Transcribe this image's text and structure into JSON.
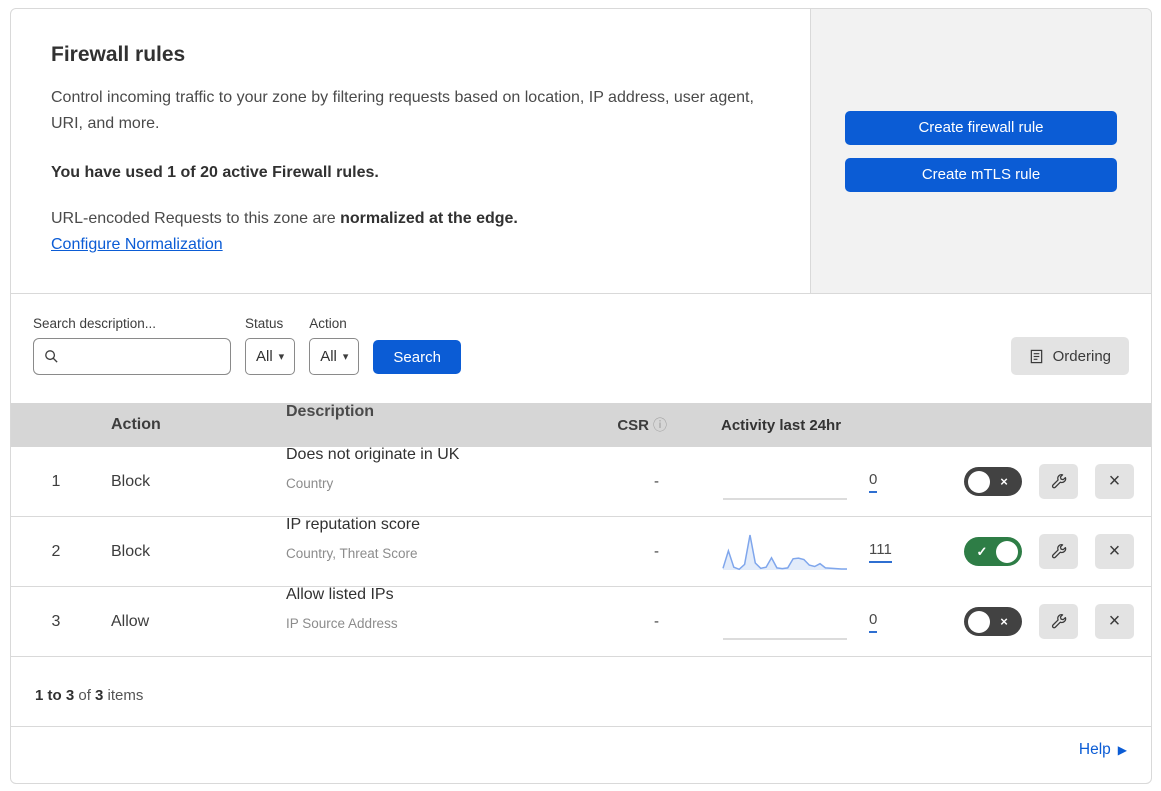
{
  "header": {
    "title": "Firewall rules",
    "description": "Control incoming traffic to your zone by filtering requests based on location, IP address, user agent, URI, and more.",
    "usage": "You have used 1 of 20 active Firewall rules.",
    "normalization_text": "URL-encoded Requests to this zone are ",
    "normalization_bold": "normalized at the edge.",
    "normalization_link": "Configure Normalization"
  },
  "actions_panel": {
    "create_firewall_rule": "Create firewall rule",
    "create_mtls_rule": "Create mTLS rule"
  },
  "filters": {
    "search_label": "Search description...",
    "search_value": "",
    "status_label": "Status",
    "status_value": "All",
    "action_label": "Action",
    "action_value": "All",
    "search_button": "Search",
    "ordering_button": "Ordering"
  },
  "table": {
    "columns": {
      "action": "Action",
      "description": "Description",
      "csr": "CSR",
      "activity": "Activity last 24hr"
    },
    "rows": [
      {
        "index": "1",
        "action": "Block",
        "title": "Does not originate in UK",
        "subtitle": "Country",
        "csr": "-",
        "count": "0",
        "enabled": false,
        "sparkline": null
      },
      {
        "index": "2",
        "action": "Block",
        "title": "IP reputation score",
        "subtitle": "Country, Threat Score",
        "csr": "-",
        "count": "111",
        "enabled": true,
        "sparkline": [
          5,
          55,
          8,
          2,
          16,
          100,
          20,
          5,
          8,
          35,
          6,
          4,
          6,
          32,
          34,
          30,
          14,
          10,
          18,
          6,
          5,
          4,
          3,
          3
        ]
      },
      {
        "index": "3",
        "action": "Allow",
        "title": "Allow listed IPs",
        "subtitle": "IP Source Address",
        "csr": "-",
        "count": "0",
        "enabled": false,
        "sparkline": null
      }
    ]
  },
  "footer": {
    "range_bold": "1 to 3",
    "of_text": " of ",
    "total_bold": "3",
    "items_text": " items",
    "help_link": "Help"
  },
  "icons": {
    "caret": "▾",
    "info": "ⓘ",
    "check": "✓",
    "close": "×",
    "help_arrow": "▶"
  },
  "colors": {
    "primary_blue": "#0b5cd5",
    "toggle_on_green": "#2e7d46",
    "toggle_off_gray": "#424242",
    "sparkline_blue": "#7fa6ec",
    "table_header_gray": "#d6d6d6",
    "panel_gray": "#f2f2f2"
  }
}
